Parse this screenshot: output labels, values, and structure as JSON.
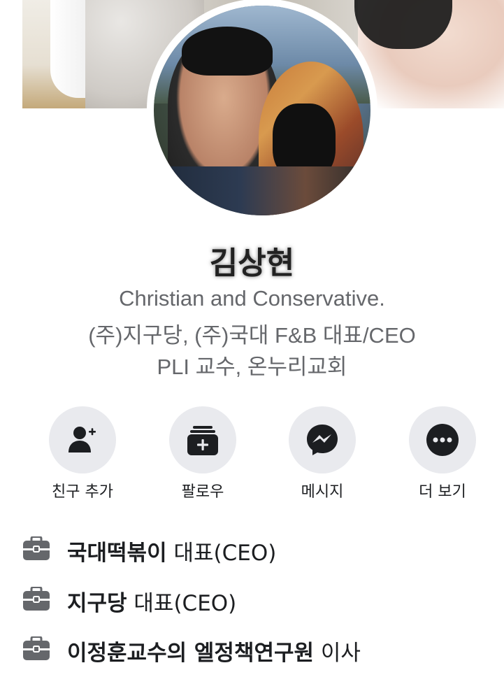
{
  "profile": {
    "name": "김상현",
    "bio": [
      "Christian and Conservative.",
      "(주)지구당, (주)국대 F&B  대표/CEO",
      "PLI 교수, 온누리교회"
    ]
  },
  "actions": [
    {
      "label": "친구 추가",
      "icon": "add-friend-icon"
    },
    {
      "label": "팔로우",
      "icon": "follow-icon"
    },
    {
      "label": "메시지",
      "icon": "messenger-icon"
    },
    {
      "label": "더 보기",
      "icon": "more-icon"
    }
  ],
  "work": [
    {
      "company": "국대떡볶이",
      "role": " 대표(CEO)",
      "icon": "briefcase-icon"
    },
    {
      "company": "지구당",
      "role": " 대표(CEO)",
      "icon": "briefcase-icon"
    },
    {
      "company": "이정훈교수의 엘정책연구원",
      "role": " 이사",
      "icon": "briefcase-icon"
    }
  ],
  "colors": {
    "action_bg": "#e9eaee",
    "icon_fill": "#1c1e21",
    "secondary_text": "#65676b"
  }
}
